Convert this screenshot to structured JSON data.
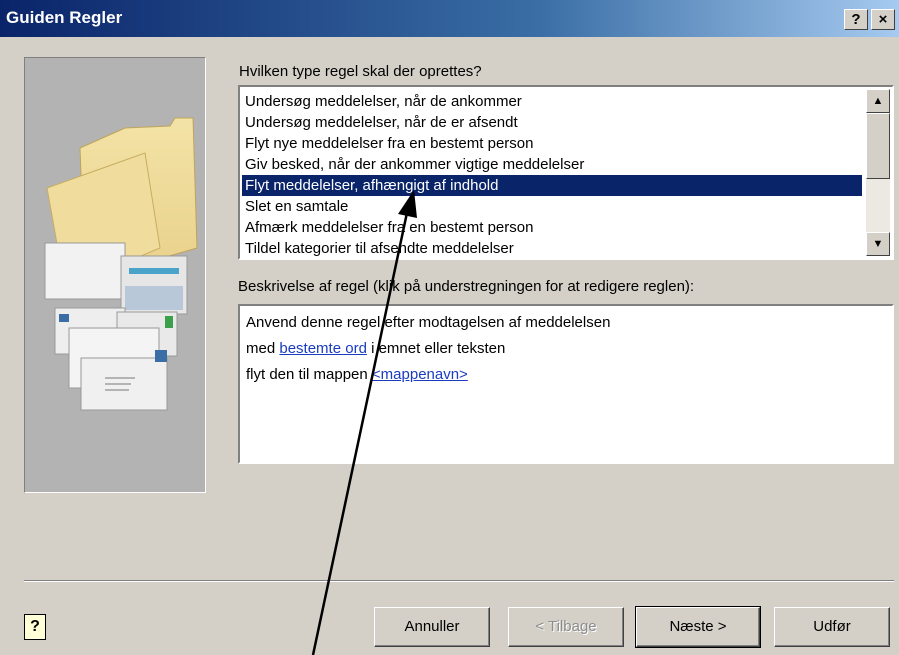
{
  "window": {
    "title": "Guiden Regler",
    "help_button": "?",
    "close_button": "×"
  },
  "rule_type": {
    "label": "Hvilken type regel skal der oprettes?",
    "items": [
      "Undersøg meddelelser, når de ankommer",
      "Undersøg meddelelser, når de er afsendt",
      "Flyt nye meddelelser fra en bestemt person",
      "Giv besked, når der ankommer vigtige meddelelser",
      "Flyt meddelelser, afhængigt af indhold",
      "Slet en samtale",
      "Afmærk meddelelser fra en bestemt person",
      "Tildel kategorier til afsendte meddelelser"
    ],
    "selected_item": "Flyt meddelelser, afhængigt af indhold"
  },
  "description": {
    "label": "Beskrivelse af regel (klik på understregningen for at redigere reglen):",
    "line1": "Anvend denne regel efter modtagelsen af meddelelsen",
    "line2_prefix": "med ",
    "line2_link": "bestemte ord",
    "line2_suffix": " i emnet eller teksten",
    "line3_prefix": "flyt den til mappen ",
    "line3_link": "<mappenavn>"
  },
  "buttons": {
    "cancel": "Annuller",
    "back": "< Tilbage",
    "next": "Næste >",
    "finish": "Udfør",
    "help": "?"
  },
  "icons": {
    "scroll_up": "scroll-up-arrow-icon",
    "scroll_down": "scroll-down-arrow-icon",
    "help": "help-icon",
    "folder_illustration": "folder-envelopes-icon",
    "annotation": "arrow-annotation-icon"
  }
}
